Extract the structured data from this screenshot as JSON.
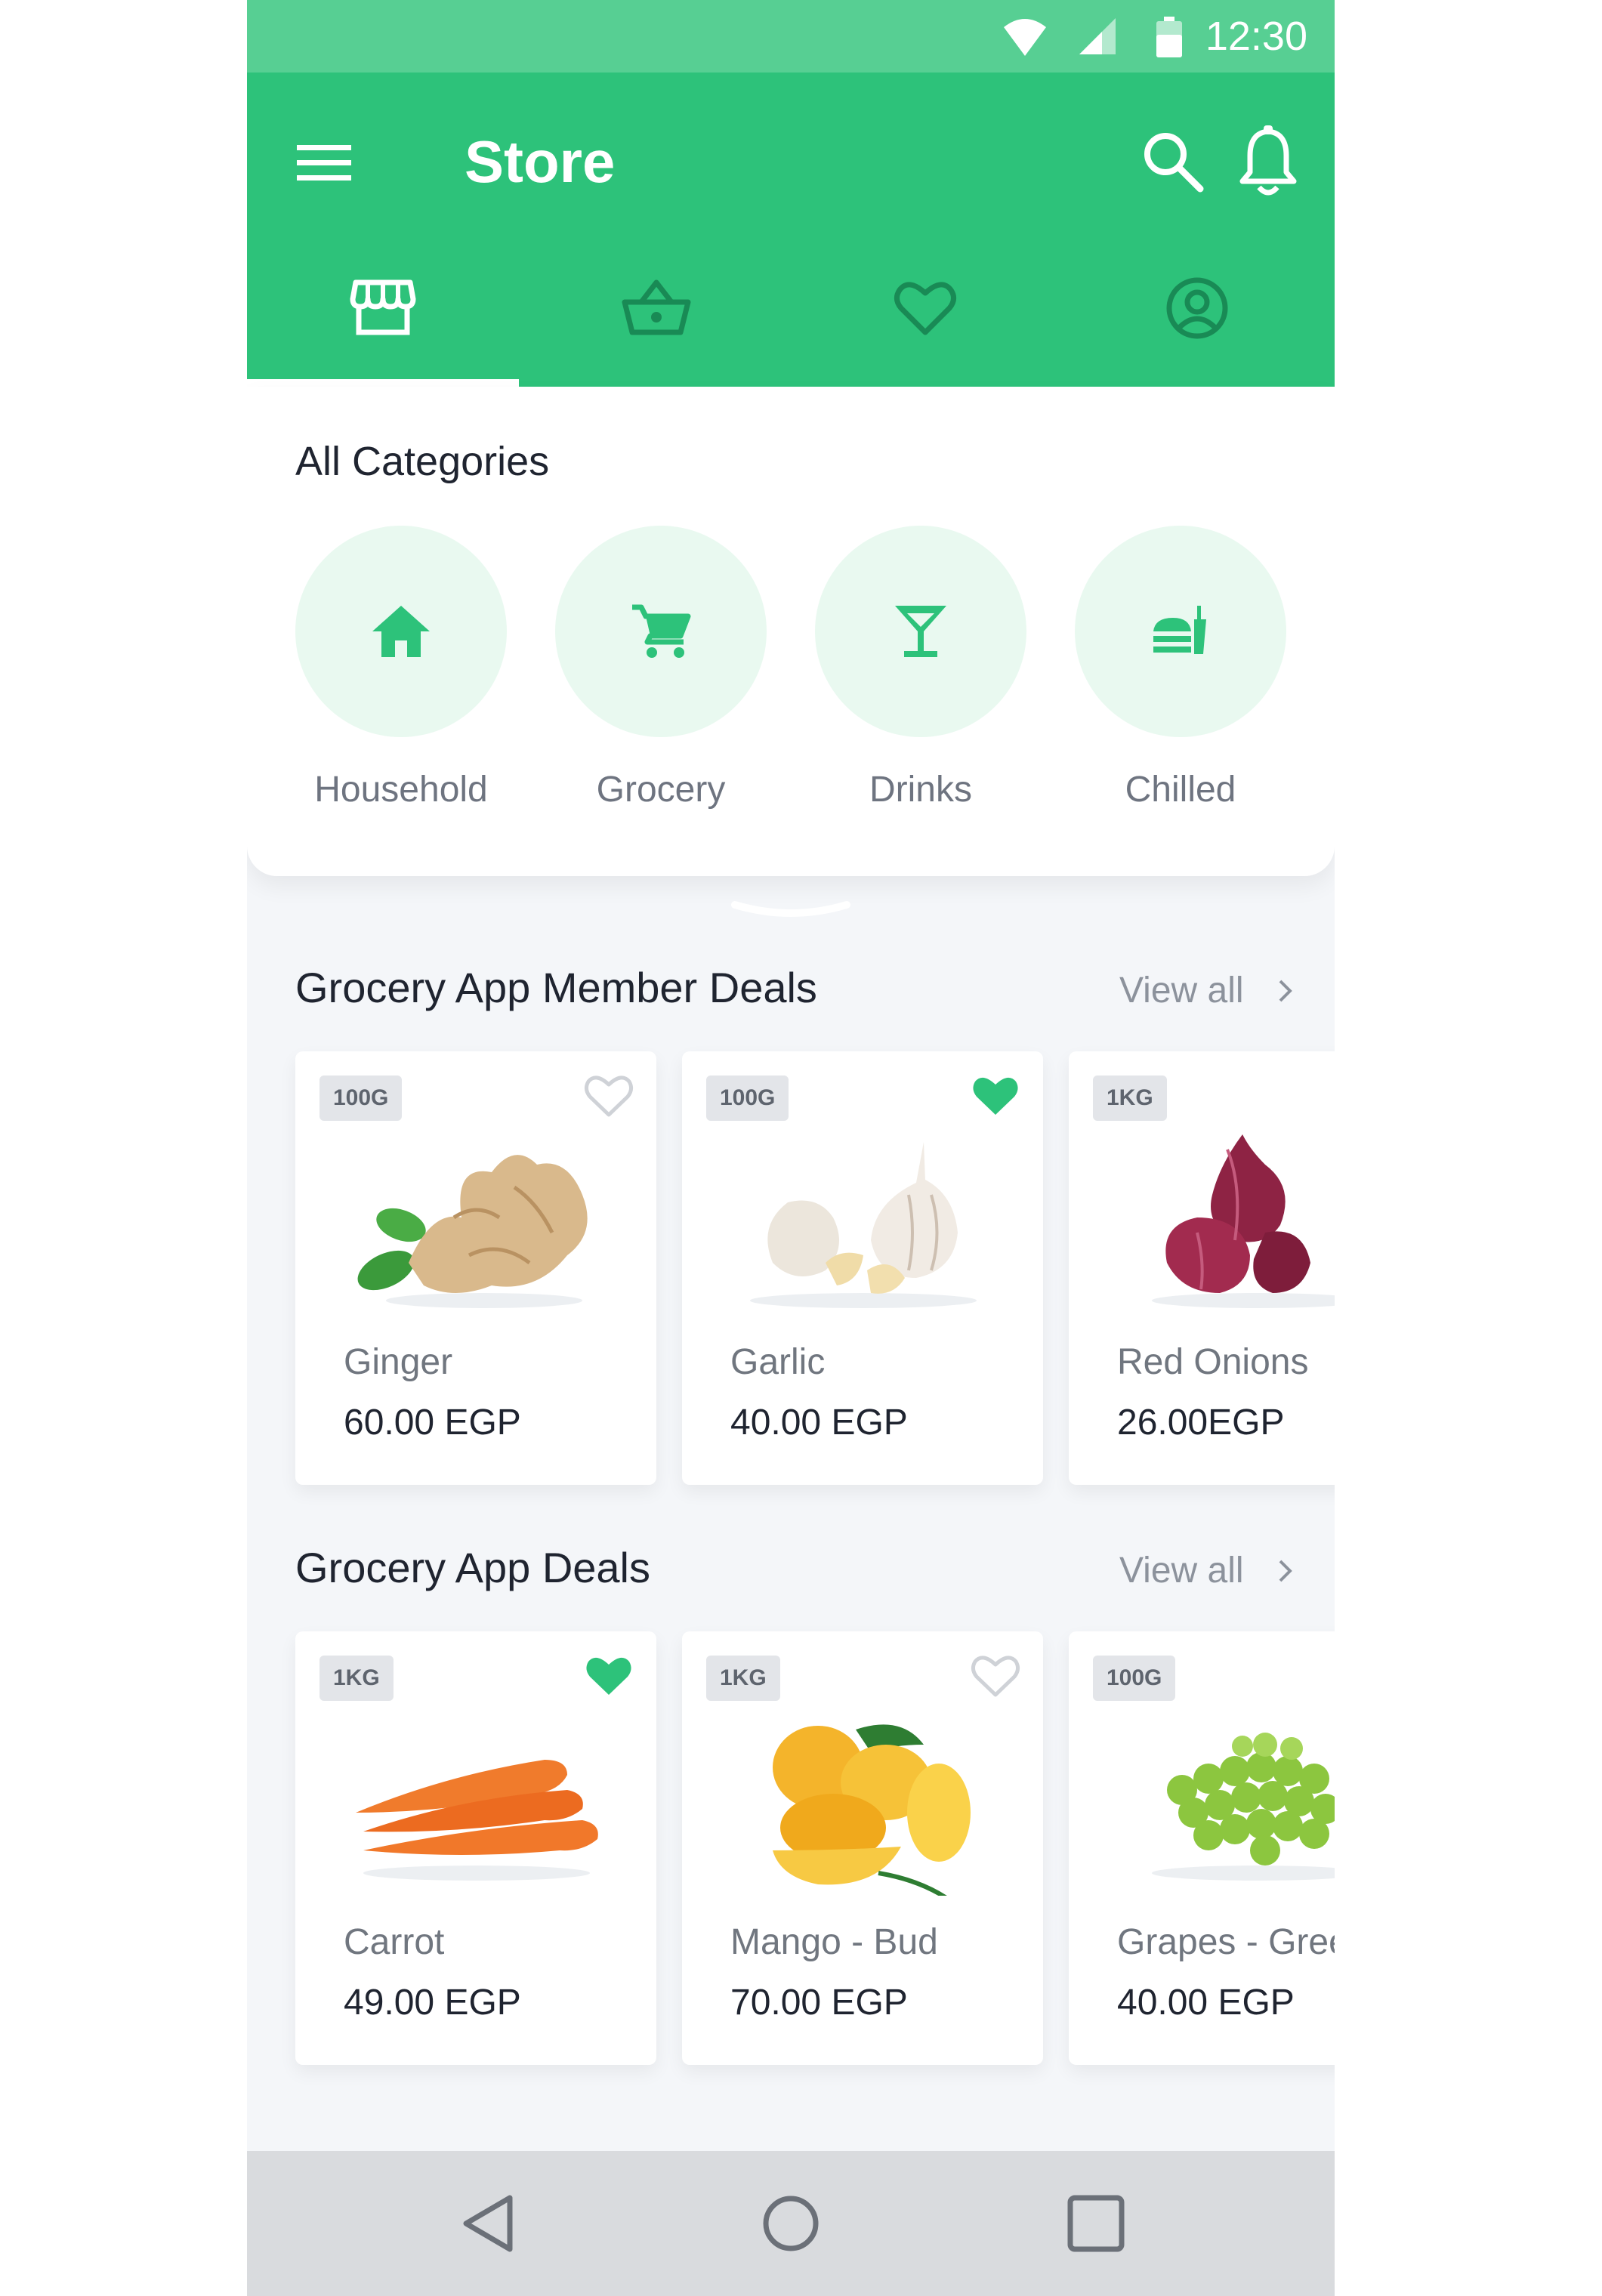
{
  "status_bar": {
    "time": "12:30",
    "icons": [
      "wifi-icon",
      "signal-icon",
      "battery-icon"
    ]
  },
  "app_bar": {
    "title": "Store",
    "actions": [
      "search-icon",
      "bell-icon"
    ],
    "tabs": [
      {
        "icon": "store-icon",
        "selected": true
      },
      {
        "icon": "basket-icon",
        "selected": false
      },
      {
        "icon": "heart-icon",
        "selected": false
      },
      {
        "icon": "account-icon",
        "selected": false
      }
    ]
  },
  "categories": {
    "heading": "All Categories",
    "items": [
      {
        "label": "Household",
        "icon": "home-icon"
      },
      {
        "label": "Grocery",
        "icon": "cart-icon"
      },
      {
        "label": "Drinks",
        "icon": "cocktail-icon"
      },
      {
        "label": "Chilled",
        "icon": "food-icon"
      }
    ]
  },
  "sections": [
    {
      "title": "Grocery App Member Deals",
      "view_all": "View all",
      "products": [
        {
          "badge": "100G",
          "name": "Ginger",
          "price": "60.00 EGP",
          "favorite": false,
          "image": "ginger-image"
        },
        {
          "badge": "100G",
          "name": "Garlic",
          "price": "40.00 EGP",
          "favorite": true,
          "image": "garlic-image"
        },
        {
          "badge": "1KG",
          "name": "Red Onions",
          "price": "26.00EGP",
          "favorite": false,
          "image": "red-onions-image"
        }
      ]
    },
    {
      "title": "Grocery App Deals",
      "view_all": "View all",
      "products": [
        {
          "badge": "1KG",
          "name": "Carrot",
          "price": "49.00 EGP",
          "favorite": true,
          "image": "carrot-image"
        },
        {
          "badge": "1KG",
          "name": "Mango - Bud",
          "price": "70.00 EGP",
          "favorite": false,
          "image": "mango-image"
        },
        {
          "badge": "100G",
          "name": "Grapes - Green",
          "price": "40.00 EGP",
          "favorite": false,
          "image": "grapes-image"
        }
      ]
    }
  ],
  "nav_bar": [
    "back-icon",
    "home-circle-icon",
    "recents-icon"
  ],
  "colors": {
    "primary": "#2dc27a",
    "status_bar": "#57cf93",
    "accent_light": "#e9f9f0",
    "favorite": "#2dc27a"
  }
}
